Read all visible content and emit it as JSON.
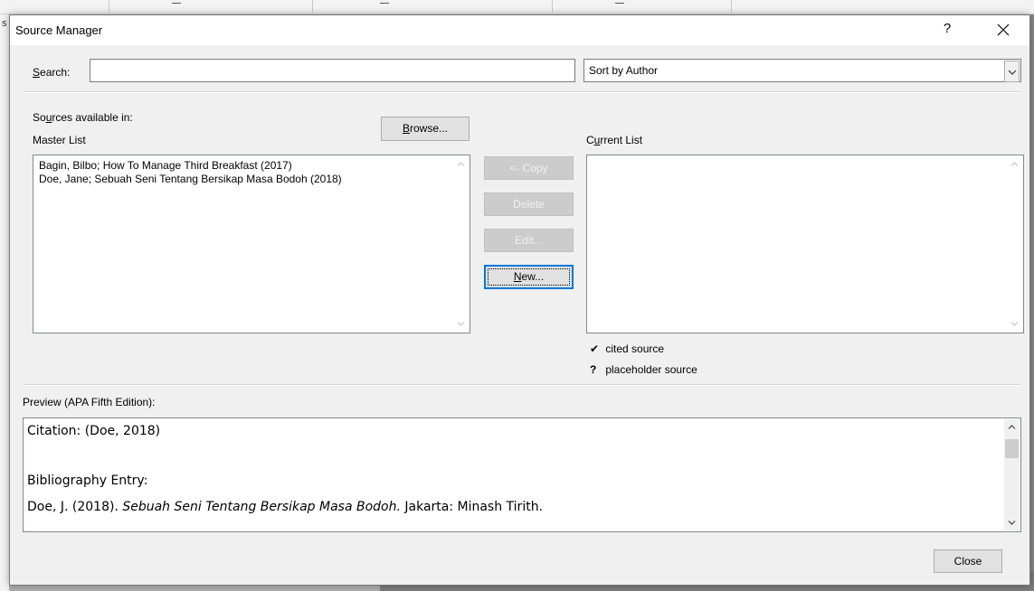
{
  "dialog": {
    "title": "Source Manager",
    "help_label": "?",
    "close_glyph": "close-icon"
  },
  "search": {
    "label_prefix": "",
    "label_hotkey": "S",
    "label_rest": "earch:",
    "value": ""
  },
  "sort": {
    "selected": "Sort by Author"
  },
  "sources_available": {
    "label_a": "So",
    "label_hotkey": "u",
    "label_b": "rces available in:",
    "list_name": "Master List",
    "browse_hotkey": "B",
    "browse_rest": "rowse..."
  },
  "master_list": {
    "items": [
      "Bagin, Bilbo; How To Manage Third Breakfast (2017)",
      "Doe, Jane; Sebuah Seni Tentang Bersikap Masa Bodoh (2018)"
    ]
  },
  "actions": {
    "copy": "<- Copy",
    "delete": "Delete",
    "edit": "Edit...",
    "new_hotkey": "N",
    "new_rest": "ew..."
  },
  "current_list": {
    "label_a": "C",
    "label_hotkey": "u",
    "label_b": "rrent List",
    "items": []
  },
  "legend": {
    "cited_symbol": "✔",
    "cited_label": "cited source",
    "placeholder_symbol": "?",
    "placeholder_label": "placeholder source"
  },
  "preview": {
    "label": "Preview (APA Fifth Edition):",
    "citation": "Citation:  (Doe, 2018)",
    "bibliography_heading": "Bibliography Entry:",
    "entry_author": "Doe, J. (2018). ",
    "entry_title": "Sebuah Seni Tentang Bersikap Masa Bodoh.",
    "entry_rest": " Jakarta: Minash Tirith."
  },
  "footer": {
    "close_label": "Close"
  }
}
